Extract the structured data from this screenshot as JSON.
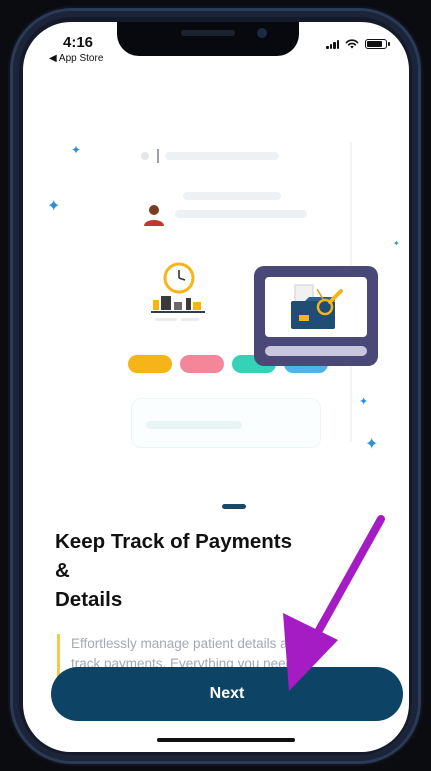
{
  "status_bar": {
    "time": "4:16",
    "back_label": "◀ App Store"
  },
  "onboarding": {
    "title_lines": [
      "Keep Track of Payments",
      "&",
      "Details"
    ],
    "description_lines": [
      "Effortlessly manage patient details and",
      "track payments. Everything you need is"
    ],
    "next_label": "Next",
    "page_indicator_active": 1
  },
  "colors": {
    "primary_button": "#0d4466",
    "accent_pills": [
      "#f6b419",
      "#f5869a",
      "#34d2b7",
      "#4eb3e8"
    ],
    "annotation_arrow": "#a51bc4",
    "description_accent": "#f7c948"
  },
  "icons": {
    "signal": "cellular-signal-icon",
    "wifi": "wifi-icon",
    "battery": "battery-icon",
    "sparkle": "sparkle-icon",
    "avatar": "user-avatar-icon",
    "clock": "clock-icon",
    "folder": "folder-icon",
    "arrow": "annotation-arrow-icon"
  }
}
